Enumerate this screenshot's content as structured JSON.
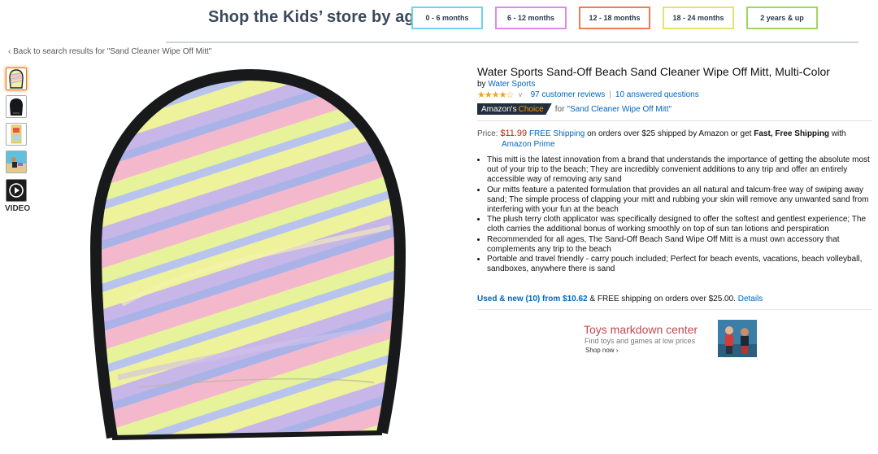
{
  "banner": {
    "title": "Shop the Kids’ store by age",
    "age_buttons": [
      {
        "label": "0 - 6 months",
        "color": "#6fd4e8"
      },
      {
        "label": "6 - 12 months",
        "color": "#e08ae6"
      },
      {
        "label": "12 - 18 months",
        "color": "#f07a55"
      },
      {
        "label": "18 - 24 months",
        "color": "#e8e070"
      },
      {
        "label": "2 years & up",
        "color": "#9ed85a"
      }
    ]
  },
  "breadcrumb": "‹ Back to search results for \"Sand Cleaner Wipe Off Mitt\"",
  "thumbnails": {
    "video_label": "VIDEO",
    "icons": [
      "mitt-pastel-thumbnail",
      "mitt-black-thumbnail",
      "package-thumbnail",
      "beach-scene-thumbnail",
      "play-video-icon"
    ]
  },
  "product": {
    "title": "Water Sports Sand-Off Beach Sand Cleaner Wipe Off Mitt, Multi-Color",
    "by_label": "by",
    "brand": "Water Sports",
    "rating": {
      "stars_text": "★★★★☆",
      "stars_value": 4,
      "chevron": "˅",
      "reviews": "97 customer reviews",
      "separator": "|",
      "questions": "10 answered questions"
    },
    "choice": {
      "badge_a": "Amazon's",
      "badge_b": "Choice",
      "for_label": "for",
      "query": "\"Sand Cleaner Wipe Off Mitt\""
    },
    "price": {
      "label": "Price:",
      "value": "$11.99",
      "free_shipping": "FREE Shipping",
      "rest_a": "on orders over $25 shipped by Amazon or get",
      "fast": "Fast, Free Shipping",
      "rest_b": "with",
      "prime": "Amazon Prime"
    },
    "bullets": [
      "This mitt is the latest innovation from a brand that understands the importance of getting the absolute most out of your trip to the beach; They are incredibly convenient additions to any trip and offer an entirely accessible way of removing any sand",
      "Our mitts feature a patented formulation that provides an all natural and talcum-free way of swiping away sand; The simple process of clapping your mitt and rubbing your skin will remove any unwanted sand from interfering with your fun at the beach",
      "The plush terry cloth applicator was specifically designed to offer the softest and gentlest experience; The cloth carries the additional bonus of working smoothly on top of sun tan lotions and perspiration",
      "Recommended for all ages, The Sand-Off Beach Sand Wipe Off Mitt is a must own accessory that complements any trip to the beach",
      "Portable and travel friendly - carry pouch included; Perfect for beach events, vacations, beach volleyball, sandboxes, anywhere there is sand"
    ],
    "used": {
      "link": "Used & new (10) from $10.62",
      "rest": "& FREE shipping on orders over $25.00.",
      "details": "Details"
    }
  },
  "ad": {
    "title": "Toys markdown center",
    "subtitle": "Find toys and games at low prices",
    "cta": "Shop now ›"
  }
}
